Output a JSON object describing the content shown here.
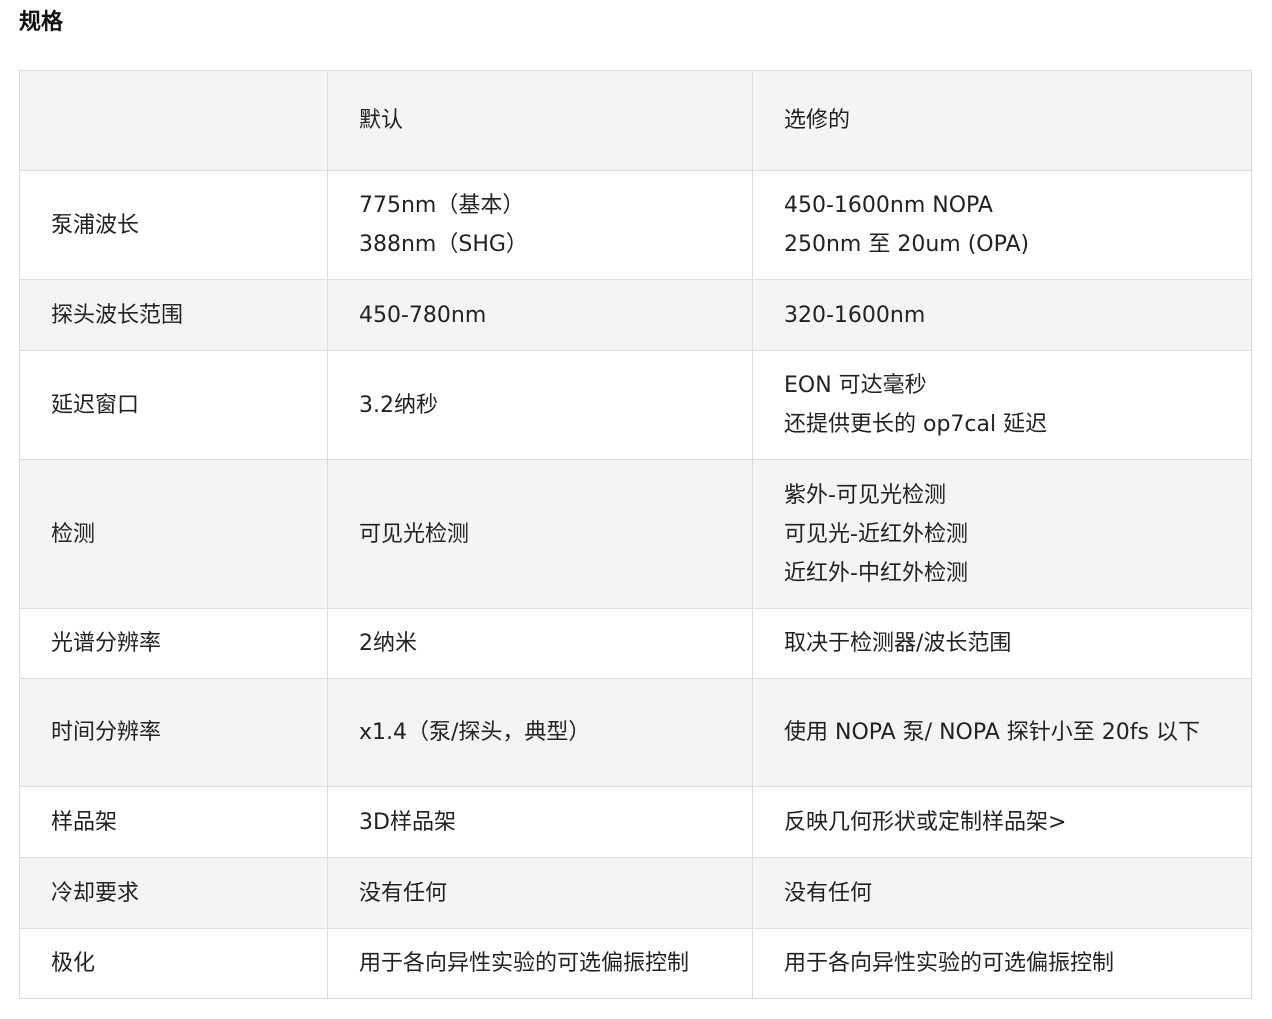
{
  "title": "规格",
  "headers": [
    "",
    "默认",
    "选修的"
  ],
  "rows": [
    {
      "label": "泵浦波长",
      "default": [
        "775nm（基本）",
        "388nm（SHG）"
      ],
      "optional": [
        "450-1600nm NOPA",
        "250nm 至 20um (OPA)"
      ]
    },
    {
      "label": "探头波长范围",
      "default": [
        "450-780nm"
      ],
      "optional": [
        "320-1600nm"
      ]
    },
    {
      "label": "延迟窗口",
      "default": [
        "3.2纳秒"
      ],
      "optional": [
        "EON 可达毫秒",
        "还提供更长的 op7cal 延迟"
      ]
    },
    {
      "label": "检测",
      "default": [
        "可见光检测"
      ],
      "optional": [
        "紫外-可见光检测",
        "可见光-近红外检测",
        "近红外-中红外检测"
      ]
    },
    {
      "label": "光谱分辨率",
      "default": [
        "2纳米"
      ],
      "optional": [
        "取决于检测器/波长范围"
      ]
    },
    {
      "label": "时间分辨率",
      "default": [
        "x1.4（泵/探头，典型）"
      ],
      "optional": [
        "使用 NOPA 泵/ NOPA 探针小至 20fs 以下"
      ]
    },
    {
      "label": "样品架",
      "default": [
        "3D样品架"
      ],
      "optional": [
        "反映几何形状或定制样品架>"
      ]
    },
    {
      "label": "冷却要求",
      "default": [
        "没有任何"
      ],
      "optional": [
        "没有任何"
      ]
    },
    {
      "label": "极化",
      "default": [
        "用于各向异性实验的可选偏振控制"
      ],
      "optional": [
        "用于各向异性实验的可选偏振控制"
      ]
    }
  ]
}
